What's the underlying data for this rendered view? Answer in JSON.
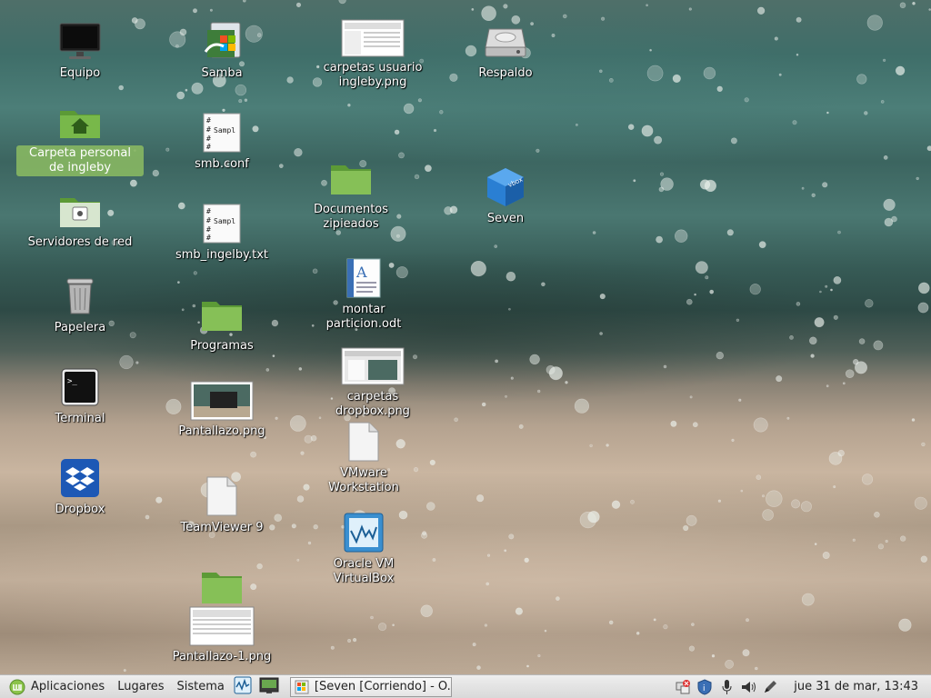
{
  "desktop": {
    "icons": [
      {
        "label": "Equipo",
        "icon": "monitor-icon"
      },
      {
        "label": "Carpeta personal de ingleby",
        "icon": "home-folder-icon",
        "selected": true
      },
      {
        "label": "Servidores de red",
        "icon": "network-folder-icon"
      },
      {
        "label": "Papelera",
        "icon": "trash-icon"
      },
      {
        "label": "Terminal",
        "icon": "terminal-icon"
      },
      {
        "label": "Dropbox",
        "icon": "dropbox-icon"
      },
      {
        "label": "Samba",
        "icon": "samba-icon"
      },
      {
        "label": "smb.conf",
        "icon": "text-file-icon"
      },
      {
        "label": "smb_ingelby.txt",
        "icon": "text-file-icon"
      },
      {
        "label": "Programas",
        "icon": "folder-icon"
      },
      {
        "label": "Pantallazo.png",
        "icon": "image-thumbnail-icon"
      },
      {
        "label": "TeamViewer 9",
        "icon": "blank-file-icon"
      },
      {
        "label": "Pantallazo-1.png",
        "icon": "image-thumbnail-icon"
      },
      {
        "label": "carpetas usuario ingleby.png",
        "icon": "image-thumbnail-icon"
      },
      {
        "label": "Documentos zipieados",
        "icon": "folder-icon"
      },
      {
        "label": "montar particion.odt",
        "icon": "document-icon"
      },
      {
        "label": "carpetas dropbox.png",
        "icon": "image-thumbnail-icon"
      },
      {
        "label": "VMware Workstation",
        "icon": "blank-file-icon"
      },
      {
        "label": "Oracle VM VirtualBox",
        "icon": "virtualbox-icon"
      },
      {
        "label": "Respaldo",
        "icon": "drive-icon"
      },
      {
        "label": "Seven",
        "icon": "vbox-cube-icon"
      }
    ],
    "file_thumb_text": "Sampl"
  },
  "panel": {
    "menu_label": "Aplicaciones",
    "places_label": "Lugares",
    "system_label": "Sistema",
    "task_label": "[Seven [Corriendo] - O...",
    "clock": "jue 31 de mar, 13:43",
    "tray_icons": [
      "network-icon",
      "update-shield-icon",
      "microphone-icon",
      "volume-icon",
      "pen-icon"
    ]
  }
}
